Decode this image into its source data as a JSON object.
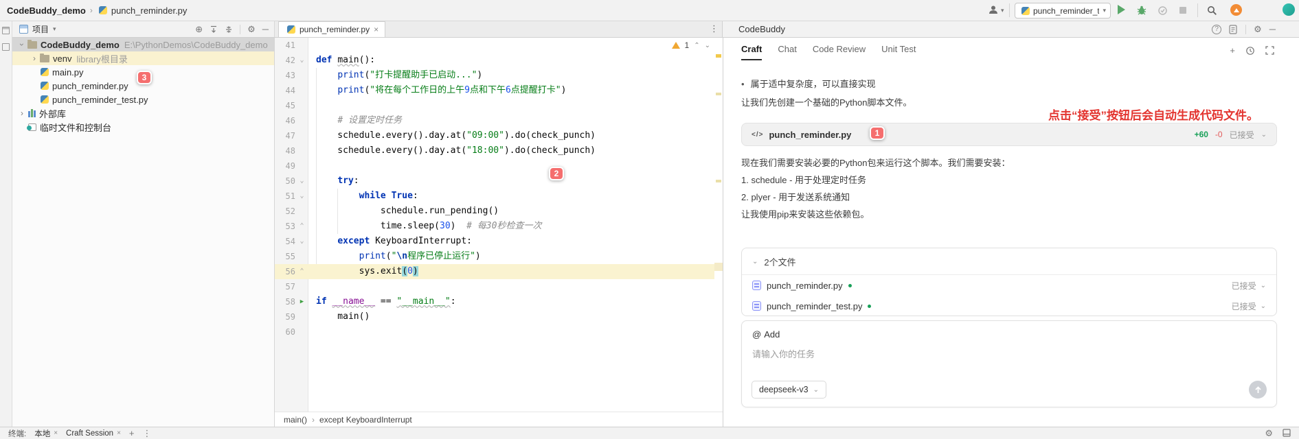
{
  "colors": {
    "accent_run_green": "#59A869",
    "badge_red": "#F56E6E",
    "annotation_red": "#E3342F",
    "string_green": "#067D17",
    "keyword_blue": "#0033B3",
    "added_green": "#18A058",
    "removed_red": "#E25A5A",
    "warning_yellow": "#F0A732"
  },
  "title_bar": {
    "project_crumb": "CodeBuddy_demo",
    "file_crumb": "punch_reminder.py",
    "run_config": "punch_reminder_test"
  },
  "project_panel": {
    "header": "项目",
    "tree": [
      {
        "indent": 0,
        "chevron": "open",
        "icon": "folder",
        "name": "CodeBuddy_demo",
        "bold": true,
        "suffix": "E:\\PythonDemos\\CodeBuddy_demo",
        "state": "selected"
      },
      {
        "indent": 1,
        "chevron": "closed",
        "icon": "folder",
        "name": "venv",
        "suffix": "library根目录",
        "state": "hl-yellow"
      },
      {
        "indent": 1,
        "chevron": null,
        "icon": "py",
        "name": "main.py"
      },
      {
        "indent": 1,
        "chevron": null,
        "icon": "py",
        "name": "punch_reminder.py"
      },
      {
        "indent": 1,
        "chevron": null,
        "icon": "py",
        "name": "punch_reminder_test.py"
      },
      {
        "indent": 0,
        "chevron": "closed",
        "icon": "lib",
        "name": "外部库"
      },
      {
        "indent": 0,
        "chevron": null,
        "icon": "console",
        "name": "临时文件和控制台"
      }
    ]
  },
  "editor": {
    "tab": "punch_reminder.py",
    "warning_count": "1",
    "breadcrumb": [
      "main()",
      "except KeyboardInterrupt"
    ],
    "lines": [
      {
        "n": 41,
        "t": []
      },
      {
        "n": 42,
        "f": "d",
        "t": [
          [
            "k",
            "def"
          ],
          [
            "p",
            " "
          ],
          [
            "p w",
            "main"
          ],
          [
            "p",
            "():"
          ]
        ]
      },
      {
        "n": 43,
        "t": [
          [
            "p",
            "    "
          ],
          [
            "b",
            "print"
          ],
          [
            "p",
            "("
          ],
          [
            "s",
            "\"打卡提醒助手已启动...\""
          ],
          [
            "p",
            ")"
          ]
        ]
      },
      {
        "n": 44,
        "t": [
          [
            "p",
            "    "
          ],
          [
            "b",
            "print"
          ],
          [
            "p",
            "("
          ],
          [
            "s",
            "\"将在每个工作日的上午"
          ],
          [
            "ns",
            "9"
          ],
          [
            "s",
            "点和下午"
          ],
          [
            "ns",
            "6"
          ],
          [
            "s",
            "点提醒打卡\""
          ],
          [
            "p",
            ")"
          ]
        ]
      },
      {
        "n": 45,
        "t": []
      },
      {
        "n": 46,
        "t": [
          [
            "p",
            "    "
          ],
          [
            "c",
            "# 设置定时任务"
          ]
        ]
      },
      {
        "n": 47,
        "t": [
          [
            "p",
            "    schedule.every().day.at("
          ],
          [
            "s",
            "\"09:00\""
          ],
          [
            "p",
            ").do(check_punch)"
          ]
        ]
      },
      {
        "n": 48,
        "t": [
          [
            "p",
            "    schedule.every().day.at("
          ],
          [
            "s",
            "\"18:00\""
          ],
          [
            "p",
            ").do(check_punch)"
          ]
        ]
      },
      {
        "n": 49,
        "t": []
      },
      {
        "n": 50,
        "f": "d",
        "t": [
          [
            "p",
            "    "
          ],
          [
            "k",
            "try"
          ],
          [
            "p",
            ":"
          ]
        ]
      },
      {
        "n": 51,
        "f": "d",
        "t": [
          [
            "p",
            "        "
          ],
          [
            "k",
            "while"
          ],
          [
            "p",
            " "
          ],
          [
            "k",
            "True"
          ],
          [
            "p",
            ":"
          ]
        ]
      },
      {
        "n": 52,
        "t": [
          [
            "p",
            "            schedule.run_pending()"
          ]
        ]
      },
      {
        "n": 53,
        "f": "u",
        "t": [
          [
            "p",
            "            time.sleep("
          ],
          [
            "n",
            "30"
          ],
          [
            "p",
            ")  "
          ],
          [
            "c",
            "# 每30秒检查一次"
          ]
        ]
      },
      {
        "n": 54,
        "f": "d",
        "t": [
          [
            "p",
            "    "
          ],
          [
            "k",
            "except"
          ],
          [
            "p",
            " KeyboardInterrupt:"
          ]
        ]
      },
      {
        "n": 55,
        "t": [
          [
            "p",
            "        "
          ],
          [
            "b",
            "print"
          ],
          [
            "p",
            "("
          ],
          [
            "s",
            "\""
          ],
          [
            "e",
            "\\n"
          ],
          [
            "s",
            "程序已停止运行\""
          ],
          [
            "p",
            ")"
          ]
        ]
      },
      {
        "n": 56,
        "f": "u",
        "current": true,
        "t": [
          [
            "p",
            "        sys.exit"
          ],
          [
            "h",
            "("
          ],
          [
            "n",
            "0"
          ],
          [
            "h",
            ")"
          ]
        ]
      },
      {
        "n": 57,
        "t": []
      },
      {
        "n": 58,
        "run": true,
        "t": [
          [
            "k",
            "if"
          ],
          [
            "p",
            " "
          ],
          [
            "d w",
            "__name__"
          ],
          [
            "p",
            " == "
          ],
          [
            "s w",
            "\"__main__\""
          ],
          [
            "p",
            ":"
          ]
        ]
      },
      {
        "n": 59,
        "t": [
          [
            "p",
            "    main()"
          ]
        ]
      },
      {
        "n": 60,
        "t": []
      }
    ]
  },
  "codebuddy": {
    "title": "CodeBuddy",
    "tabs": [
      {
        "label": "Craft",
        "active": true
      },
      {
        "label": "Chat",
        "active": false
      },
      {
        "label": "Code Review",
        "active": false
      },
      {
        "label": "Unit Test",
        "active": false
      }
    ],
    "bullet_line": "属于适中复杂度，可以直接实现",
    "create_line": "让我们先创建一个基础的Python脚本文件。",
    "annotation": "点击“接受”按钮后会自动生成代码文件。",
    "file_card": {
      "name": "punch_reminder.py",
      "added": "+60",
      "removed": "-0",
      "status": "已接受"
    },
    "install_para": "现在我们需要安装必要的Python包来运行这个脚本。我们需要安装：",
    "install_item1": "1. schedule - 用于处理定时任务",
    "install_item2": "2. plyer - 用于发送系统通知",
    "pip_line": "让我使用pip来安装这些依赖包。",
    "files_card": {
      "header": "2个文件",
      "files": [
        {
          "name": "punch_reminder.py",
          "status": "已接受"
        },
        {
          "name": "punch_reminder_test.py",
          "status": "已接受"
        }
      ]
    },
    "input_card": {
      "add_label": "Add",
      "at_symbol": "@",
      "placeholder": "请输入你的任务",
      "model": "deepseek-v3"
    }
  },
  "terminal_bar": {
    "label": "终端:",
    "tab_local": "本地",
    "tab_session": "Craft Session"
  },
  "badges": {
    "b1": "1",
    "b2": "2",
    "b3": "3"
  }
}
